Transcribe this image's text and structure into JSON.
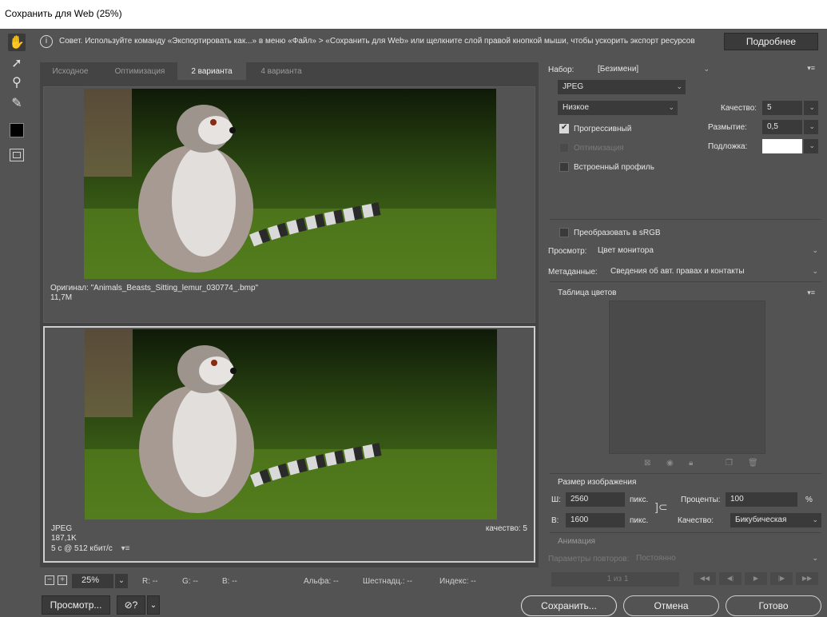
{
  "window": {
    "title": "Сохранить для Web (25%)"
  },
  "tools": [
    {
      "name": "hand-tool-icon",
      "glyph": "✋"
    },
    {
      "name": "slice-select-icon",
      "glyph": "➚"
    },
    {
      "name": "zoom-tool-icon",
      "glyph": "⚲"
    },
    {
      "name": "eyedropper-icon",
      "glyph": "✎"
    }
  ],
  "tip": {
    "icon": "ⓘ",
    "text": "Совет. Используйте команду «Экспортировать как...» в меню «Файл» > «Сохранить для Web» или щелкните слой правой кнопкой мыши, чтобы ускорить экспорт ресурсов",
    "more_label": "Подробнее"
  },
  "tabs": [
    {
      "label": "Исходное"
    },
    {
      "label": "Оптимизация"
    },
    {
      "label": "2 варианта"
    },
    {
      "label": "4 варианта"
    }
  ],
  "original": {
    "name": "Оригинал: \"Animals_Beasts_Sitting_lemur_030774_.bmp\"",
    "size": "11,7M"
  },
  "optimized": {
    "format": "JPEG",
    "size": "187,1K",
    "time": "5 с @ 512 кбит/с",
    "quality": "качество: 5"
  },
  "status": {
    "zoom": "25%",
    "r": "R: --",
    "g": "G: --",
    "b": "B: --",
    "alpha": "Альфа: --",
    "hex": "Шестнадц.: --",
    "index": "Индекс: --"
  },
  "buttons": {
    "preview": "Просмотр...",
    "save": "Сохранить...",
    "cancel": "Отмена",
    "done": "Готово"
  },
  "settings": {
    "preset_label": "Набор:",
    "preset_value": "[Безимени]",
    "format": "JPEG",
    "quality_preset": "Низкое",
    "quality_label": "Качество:",
    "quality_value": "5",
    "blur_label": "Размытие:",
    "blur_value": "0,5",
    "matte_label": "Подложка:",
    "progressive": "Прогрессивный",
    "optimize": "Оптимизация",
    "embed_profile": "Встроенный профиль",
    "convert_srgb": "Преобразовать в sRGB",
    "preview_label": "Просмотр:",
    "preview_value": "Цвет монитора",
    "metadata_label": "Метаданные:",
    "metadata_value": "Сведения об авт. правах и контакты"
  },
  "color_table": {
    "title": "Таблица цветов"
  },
  "image_size": {
    "title": "Размер изображения",
    "w_label": "Ш:",
    "w_value": "2560",
    "h_label": "В:",
    "h_value": "1600",
    "unit": "пикс.",
    "percent_label": "Проценты:",
    "percent_value": "100",
    "percent_sign": "%",
    "resample_label": "Качество:",
    "resample_value": "Бикубическая"
  },
  "animation": {
    "title": "Анимация",
    "loop_label": "Параметры повторов:",
    "loop_value": "Постоянно",
    "frame": "1 из 1"
  }
}
